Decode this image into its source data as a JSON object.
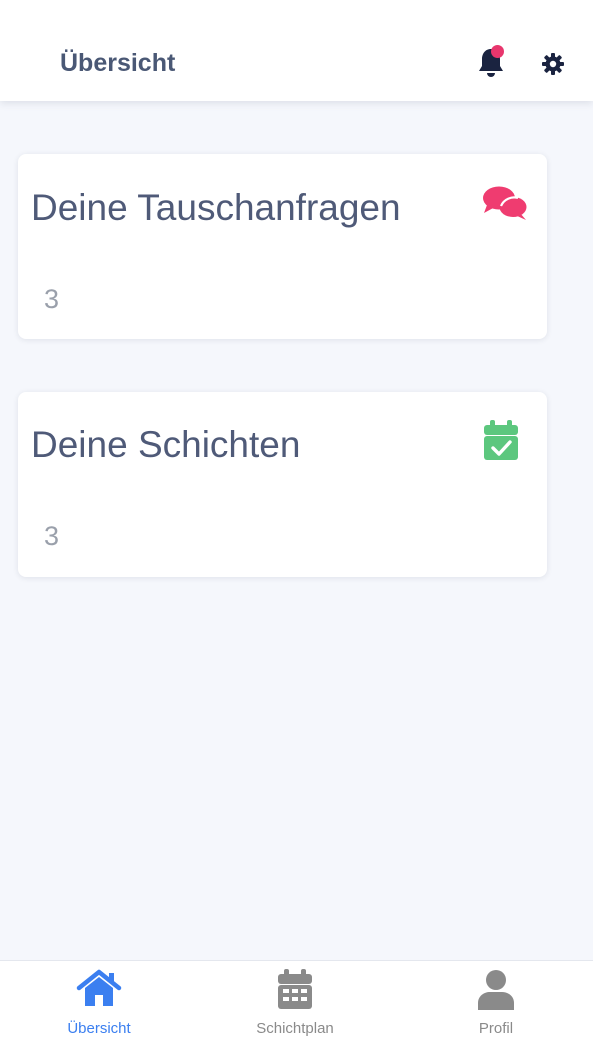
{
  "header": {
    "title": "Übersicht",
    "notification_dot_color": "#e8366d",
    "icon_color": "#1a2340"
  },
  "cards": [
    {
      "title": "Deine Tauschanfragen",
      "count": "3",
      "icon": "comments-icon",
      "icon_color": "#ef3c70"
    },
    {
      "title": "Deine Schichten",
      "count": "3",
      "icon": "calendar-check-icon",
      "icon_color": "#5cc77e"
    }
  ],
  "bottom_nav": {
    "active_color": "#3b7ff0",
    "inactive_color": "#8a8a8a",
    "items": [
      {
        "label": "Übersicht",
        "icon": "home-icon",
        "active": true
      },
      {
        "label": "Schichtplan",
        "icon": "calendar-icon",
        "active": false
      },
      {
        "label": "Profil",
        "icon": "user-icon",
        "active": false
      }
    ]
  }
}
